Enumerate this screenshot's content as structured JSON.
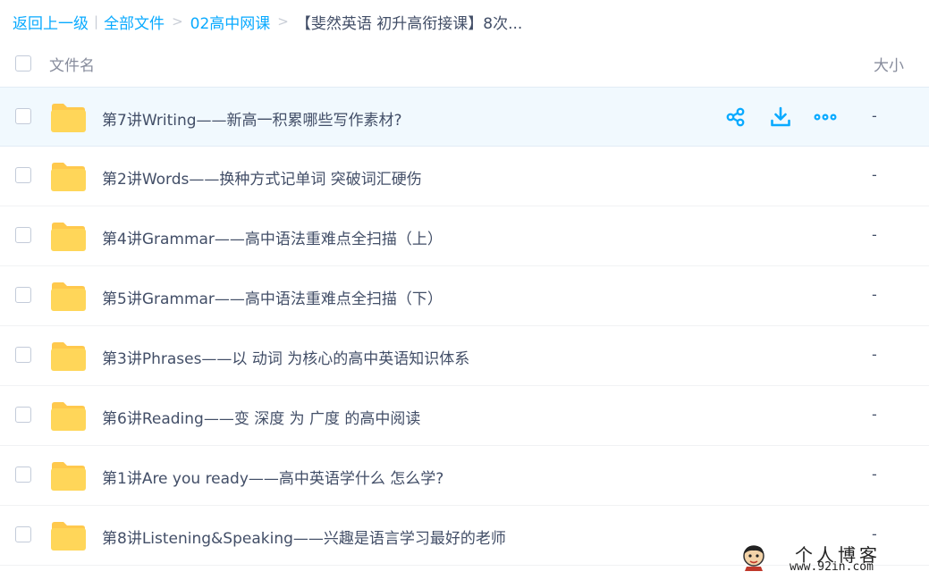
{
  "breadcrumb": {
    "back": "返回上一级",
    "all_files": "全部文件",
    "folder": "02高中网课",
    "current": "【斐然英语 初升高衔接课】8次..."
  },
  "header": {
    "name_col": "文件名",
    "size_col": "大小"
  },
  "files": [
    {
      "name": "第7讲Writing——新高一积累哪些写作素材?",
      "size": "-"
    },
    {
      "name": "第2讲Words——换种方式记单词 突破词汇硬伤",
      "size": "-"
    },
    {
      "name": "第4讲Grammar——高中语法重难点全扫描（上）",
      "size": "-"
    },
    {
      "name": "第5讲Grammar——高中语法重难点全扫描（下）",
      "size": "-"
    },
    {
      "name": "第3讲Phrases——以 动词 为核心的高中英语知识体系",
      "size": "-"
    },
    {
      "name": "第6讲Reading——变 深度 为 广度 的高中阅读",
      "size": "-"
    },
    {
      "name": "第1讲Are you ready——高中英语学什么 怎么学?",
      "size": "-"
    },
    {
      "name": "第8讲Listening&Speaking——兴趣是语言学习最好的老师",
      "size": "-"
    }
  ],
  "row_actions": [
    "share-icon",
    "download-icon",
    "more-icon"
  ],
  "watermark": {
    "title": "个人博客",
    "url": "www.92in.com"
  },
  "colors": {
    "accent": "#09aaff",
    "folder": "#ffd659",
    "folder_tab": "#ffc94d",
    "hover_row": "#f1f9fe"
  }
}
